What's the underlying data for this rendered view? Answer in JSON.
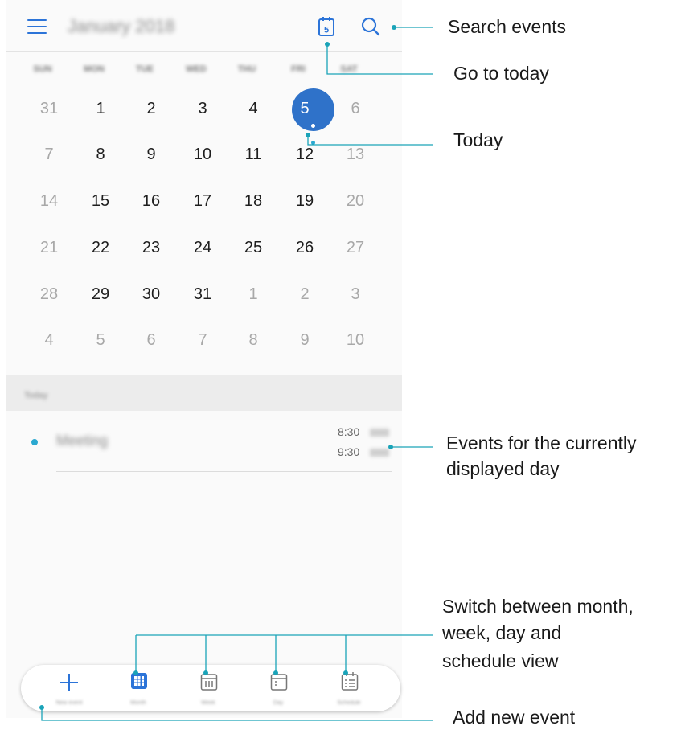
{
  "header": {
    "menu_icon": "hamburger-menu-icon",
    "month_title": "January 2018",
    "today_icon_number": "5",
    "search_icon": "magnifier-icon"
  },
  "weekdays": [
    "SUN",
    "MON",
    "TUE",
    "WED",
    "THU",
    "FRI",
    "SAT"
  ],
  "calendar": {
    "weeks": [
      [
        "31",
        "1",
        "2",
        "3",
        "4",
        "5",
        "6"
      ],
      [
        "7",
        "8",
        "9",
        "10",
        "11",
        "12",
        "13"
      ],
      [
        "14",
        "15",
        "16",
        "17",
        "18",
        "19",
        "20"
      ],
      [
        "21",
        "22",
        "23",
        "24",
        "25",
        "26",
        "27"
      ],
      [
        "28",
        "29",
        "30",
        "31",
        "1",
        "2",
        "3"
      ],
      [
        "4",
        "5",
        "6",
        "7",
        "8",
        "9",
        "10"
      ]
    ],
    "today": "5"
  },
  "events_section": {
    "label": "Today",
    "events": [
      {
        "title": "Meeting",
        "start": "8:30",
        "end": "9:30",
        "dot_color": "#2aa8d0"
      }
    ]
  },
  "bottom_nav": [
    {
      "label": "New event",
      "icon": "plus-icon"
    },
    {
      "label": "Month",
      "icon": "month-view-icon"
    },
    {
      "label": "Week",
      "icon": "week-view-icon"
    },
    {
      "label": "Day",
      "icon": "day-view-icon"
    },
    {
      "label": "Schedule",
      "icon": "schedule-view-icon"
    }
  ],
  "annotations": {
    "search": "Search events",
    "go_today": "Go to today",
    "today": "Today",
    "events_line1": "Events for the currently",
    "events_line2": "displayed day",
    "switch_line1": "Switch between month,",
    "switch_line2": "week, day and",
    "switch_line3": "schedule view",
    "add": "Add new event"
  },
  "colors": {
    "accent": "#2c74d8",
    "today_circle": "#2f72c9",
    "callout_line": "#1aa3b8",
    "event_dot": "#2aa8d0"
  }
}
